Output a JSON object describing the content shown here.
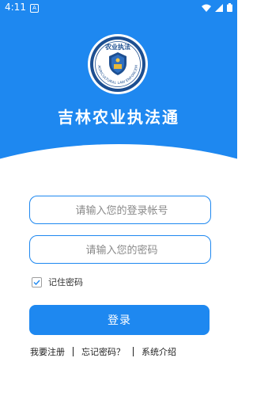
{
  "status_bar": {
    "time": "4:11",
    "notification_icon": "a-square-icon",
    "icons": [
      "wifi-icon",
      "signal-icon",
      "battery-icon"
    ]
  },
  "app": {
    "emblem_top_text": "农业执法",
    "emblem_ring_text": "AGRICULTURAL LAW ENFORCEMENT",
    "title": "吉林农业执法通"
  },
  "form": {
    "account_placeholder": "请输入您的登录帐号",
    "password_placeholder": "请输入您的密码",
    "remember_label": "记住密码",
    "remember_checked": true,
    "login_label": "登录"
  },
  "links": {
    "register": "我要注册",
    "forgot": "忘记密码？",
    "about": "系统介绍"
  },
  "colors": {
    "primary": "#1e88f0",
    "background": "#ffffff"
  }
}
